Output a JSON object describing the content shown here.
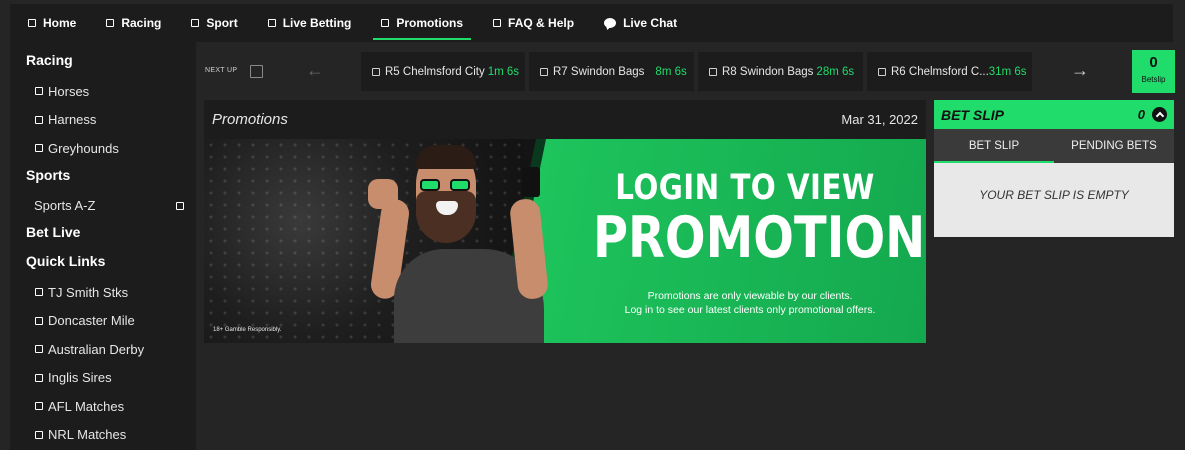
{
  "nav": {
    "items": [
      {
        "label": "Home",
        "icon": "square-icon"
      },
      {
        "label": "Racing",
        "icon": "square-icon"
      },
      {
        "label": "Sport",
        "icon": "square-icon"
      },
      {
        "label": "Live Betting",
        "icon": "square-icon"
      },
      {
        "label": "Promotions",
        "icon": "square-icon",
        "active": true
      },
      {
        "label": "FAQ & Help",
        "icon": "square-icon"
      },
      {
        "label": "Live Chat",
        "icon": "chat-bubble-icon"
      }
    ]
  },
  "sidebar": {
    "racing_heading": "Racing",
    "racing_items": [
      "Horses",
      "Harness",
      "Greyhounds"
    ],
    "sports_heading": "Sports",
    "sports_az": "Sports A-Z",
    "bet_live_heading": "Bet Live",
    "quick_links_heading": "Quick Links",
    "quick_links": [
      "TJ Smith Stks",
      "Doncaster Mile",
      "Australian Derby",
      "Inglis Sires",
      "AFL Matches",
      "NRL Matches"
    ]
  },
  "next_up": {
    "label": "NEXT UP",
    "races": [
      {
        "name": "R5 Chelmsford City",
        "time": "1m 6s"
      },
      {
        "name": "R7 Swindon Bags",
        "time": "8m 6s"
      },
      {
        "name": "R8 Swindon Bags",
        "time": "28m 6s"
      },
      {
        "name": "R6 Chelmsford C...",
        "time": "31m 6s"
      }
    ],
    "prev_arrow": "←",
    "next_arrow": "→"
  },
  "betslip_counter": {
    "count": "0",
    "label": "Betslip"
  },
  "promotions": {
    "title": "Promotions",
    "date": "Mar 31, 2022",
    "banner": {
      "line1": "LOGIN TO VIEW",
      "line2": "PROMOTIONS",
      "sub1": "Promotions are only viewable by our clients.",
      "sub2": "Log in to see our latest clients only promotional offers.",
      "gamble_note": "18+ Gamble Responsibly."
    }
  },
  "bet_slip": {
    "title": "BET SLIP",
    "count": "0",
    "tabs": [
      "BET SLIP",
      "PENDING BETS"
    ],
    "empty_message": "YOUR BET SLIP IS EMPTY"
  },
  "colors": {
    "accent": "#1fdc6b",
    "background": "#252525",
    "panel": "#1c1c1c"
  }
}
